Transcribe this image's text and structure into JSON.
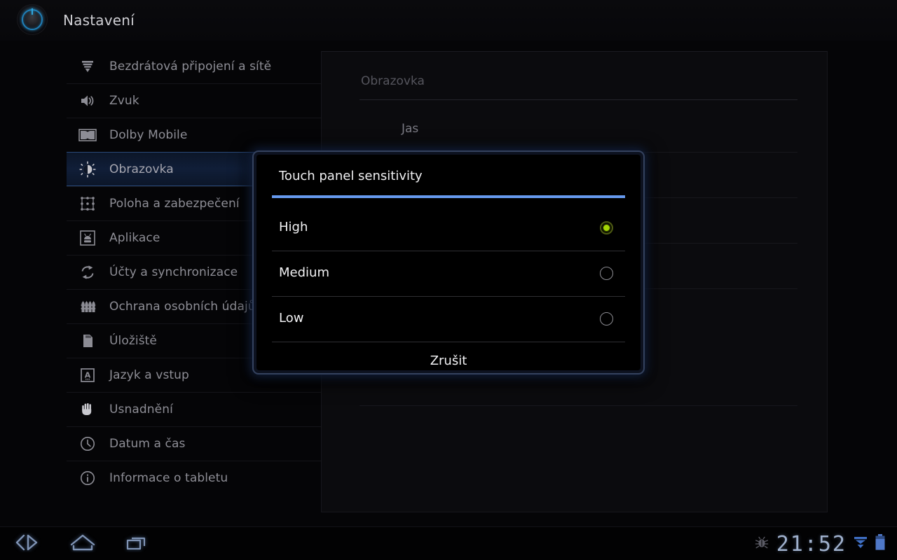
{
  "app": {
    "title": "Nastavení",
    "logo_icon": "settings-dial-icon"
  },
  "sidebar": {
    "items": [
      {
        "label": "Bezdrátová připojení a sítě",
        "icon": "wireless-networks-icon",
        "selected": false
      },
      {
        "label": "Zvuk",
        "icon": "sound-speaker-icon",
        "selected": false
      },
      {
        "label": "Dolby Mobile",
        "icon": "dolby-icon",
        "selected": false
      },
      {
        "label": "Obrazovka",
        "icon": "display-brightness-icon",
        "selected": true
      },
      {
        "label": "Poloha a zabezpečení",
        "icon": "location-security-icon",
        "selected": false
      },
      {
        "label": "Aplikace",
        "icon": "android-apps-icon",
        "selected": false
      },
      {
        "label": "Účty a synchronizace",
        "icon": "sync-accounts-icon",
        "selected": false
      },
      {
        "label": "Ochrana osobních údajů",
        "icon": "privacy-fence-icon",
        "selected": false
      },
      {
        "label": "Úložiště",
        "icon": "sdcard-storage-icon",
        "selected": false
      },
      {
        "label": "Jazyk a vstup",
        "icon": "language-input-icon",
        "selected": false
      },
      {
        "label": "Usnadnění",
        "icon": "accessibility-hand-icon",
        "selected": false
      },
      {
        "label": "Datum a čas",
        "icon": "clock-icon",
        "selected": false
      },
      {
        "label": "Informace o tabletu",
        "icon": "info-circle-icon",
        "selected": false
      }
    ]
  },
  "content": {
    "section_title": "Obrazovka",
    "preferences": [
      {
        "title": "Jas"
      }
    ]
  },
  "dialog": {
    "title": "Touch panel sensitivity",
    "accent_color": "#6699ee",
    "selected_color": "#a4d604",
    "options": [
      {
        "label": "High",
        "selected": true
      },
      {
        "label": "Medium",
        "selected": false
      },
      {
        "label": "Low",
        "selected": false
      }
    ],
    "cancel_label": "Zrušit"
  },
  "system_bar": {
    "back_icon": "back-arrow-icon",
    "home_icon": "home-icon",
    "recents_icon": "recent-apps-icon",
    "status": {
      "debug_icon": "usb-debugging-bug-icon",
      "clock": "21:52",
      "wifi_icon": "wifi-signal-icon",
      "battery_icon": "battery-icon"
    }
  }
}
